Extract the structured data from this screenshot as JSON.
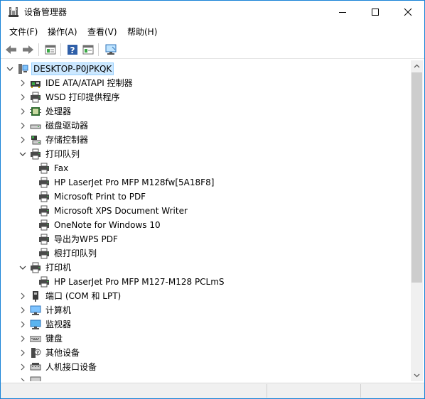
{
  "window": {
    "title": "设备管理器",
    "accent": "#1883d7"
  },
  "menu": {
    "items": [
      {
        "label": "文件(F)"
      },
      {
        "label": "操作(A)"
      },
      {
        "label": "查看(V)"
      },
      {
        "label": "帮助(H)"
      }
    ]
  },
  "toolbar": {
    "buttons": [
      "back-icon",
      "forward-icon",
      "properties-icon",
      "help-icon",
      "update-driver-icon",
      "monitor-scan-icon"
    ]
  },
  "tree": {
    "root": "DESKTOP-P0JPKQK",
    "nodes": [
      {
        "label": "IDE ATA/ATAPI 控制器",
        "icon": "ide-controller-icon",
        "state": "collapsed"
      },
      {
        "label": "WSD 打印提供程序",
        "icon": "printer-icon",
        "state": "collapsed"
      },
      {
        "label": "处理器",
        "icon": "processor-icon",
        "state": "collapsed"
      },
      {
        "label": "磁盘驱动器",
        "icon": "disk-drive-icon",
        "state": "collapsed"
      },
      {
        "label": "存储控制器",
        "icon": "storage-controller-icon",
        "state": "collapsed"
      },
      {
        "label": "打印队列",
        "icon": "printer-icon",
        "state": "expanded"
      },
      {
        "label": "Fax",
        "icon": "printer-icon",
        "state": "child"
      },
      {
        "label": "HP LaserJet Pro MFP M128fw[5A18F8]",
        "icon": "printer-icon",
        "state": "child"
      },
      {
        "label": "Microsoft Print to PDF",
        "icon": "printer-icon",
        "state": "child"
      },
      {
        "label": "Microsoft XPS Document Writer",
        "icon": "printer-icon",
        "state": "child"
      },
      {
        "label": "OneNote for Windows 10",
        "icon": "printer-icon",
        "state": "child"
      },
      {
        "label": "导出为WPS PDF",
        "icon": "printer-icon",
        "state": "child"
      },
      {
        "label": "根打印队列",
        "icon": "printer-icon",
        "state": "child"
      },
      {
        "label": "打印机",
        "icon": "printer-icon",
        "state": "expanded"
      },
      {
        "label": "HP LaserJet Pro MFP M127-M128 PCLmS",
        "icon": "printer-icon",
        "state": "child"
      },
      {
        "label": "端口 (COM 和 LPT)",
        "icon": "port-icon",
        "state": "collapsed"
      },
      {
        "label": "计算机",
        "icon": "computer-icon",
        "state": "collapsed"
      },
      {
        "label": "监视器",
        "icon": "monitor-icon",
        "state": "collapsed"
      },
      {
        "label": "键盘",
        "icon": "keyboard-icon",
        "state": "collapsed"
      },
      {
        "label": "其他设备",
        "icon": "other-devices-icon",
        "state": "collapsed"
      },
      {
        "label": "人机接口设备",
        "icon": "hid-icon",
        "state": "collapsed"
      }
    ]
  }
}
